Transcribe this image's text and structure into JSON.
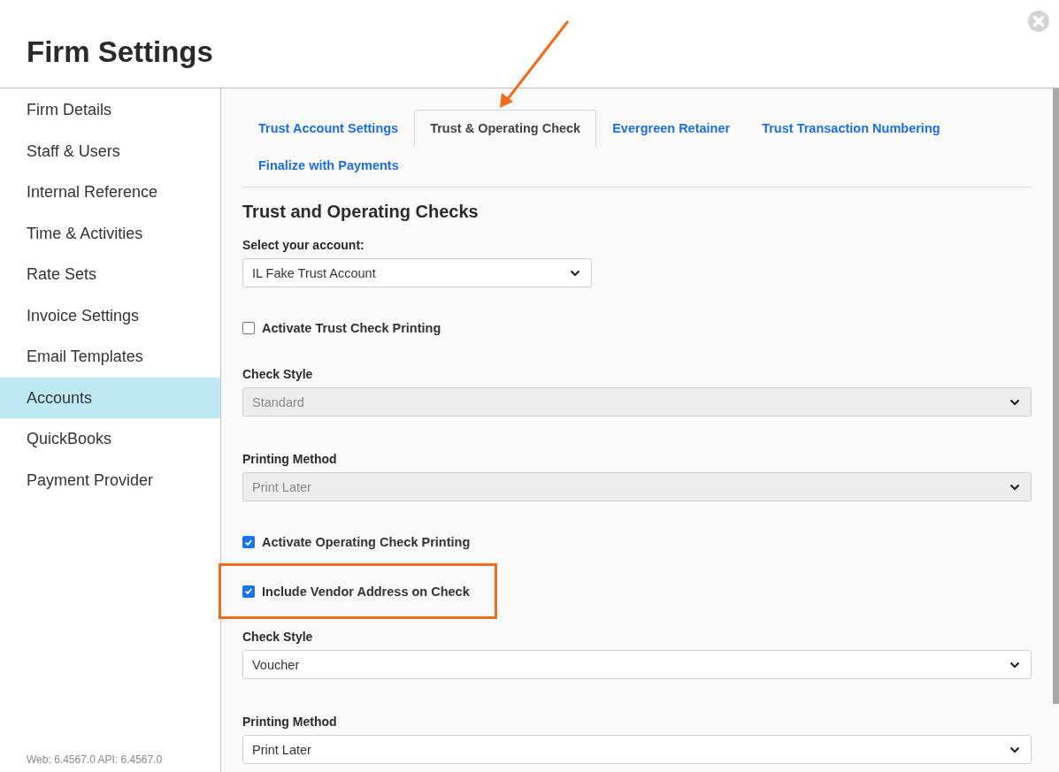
{
  "title": "Firm Settings",
  "sidebar": {
    "items": [
      {
        "label": "Firm Details",
        "selected": false
      },
      {
        "label": "Staff & Users",
        "selected": false
      },
      {
        "label": "Internal Reference",
        "selected": false
      },
      {
        "label": "Time & Activities",
        "selected": false
      },
      {
        "label": "Rate Sets",
        "selected": false
      },
      {
        "label": "Invoice Settings",
        "selected": false
      },
      {
        "label": "Email Templates",
        "selected": false
      },
      {
        "label": "Accounts",
        "selected": true
      },
      {
        "label": "QuickBooks",
        "selected": false
      },
      {
        "label": "Payment Provider",
        "selected": false
      }
    ],
    "version": "Web: 6.4567.0 API: 6.4567.0"
  },
  "tabs": [
    {
      "label": "Trust Account Settings",
      "selected": false
    },
    {
      "label": "Trust & Operating Check",
      "selected": true
    },
    {
      "label": "Evergreen Retainer",
      "selected": false
    },
    {
      "label": "Trust Transaction Numbering",
      "selected": false
    },
    {
      "label": "Finalize with Payments",
      "selected": false
    }
  ],
  "section_title": "Trust and Operating Checks",
  "form": [
    {
      "kind": "select",
      "label": "Select your account:",
      "value": "IL Fake Trust Account",
      "disabled": false
    },
    {
      "kind": "checkbox",
      "label": "Activate Trust Check Printing",
      "checked": false,
      "highlighted": false
    },
    {
      "kind": "select",
      "label": "Check Style",
      "value": "Standard",
      "disabled": true
    },
    {
      "kind": "select",
      "label": "Printing Method",
      "value": "Print Later",
      "disabled": true
    },
    {
      "kind": "checkbox",
      "label": "Activate Operating Check Printing",
      "checked": true,
      "highlighted": false
    },
    {
      "kind": "checkbox",
      "label": "Include Vendor Address on Check",
      "checked": true,
      "highlighted": true
    },
    {
      "kind": "select",
      "label": "Check Style",
      "value": "Voucher",
      "disabled": false
    },
    {
      "kind": "select",
      "label": "Printing Method",
      "value": "Print Later",
      "disabled": false
    }
  ]
}
